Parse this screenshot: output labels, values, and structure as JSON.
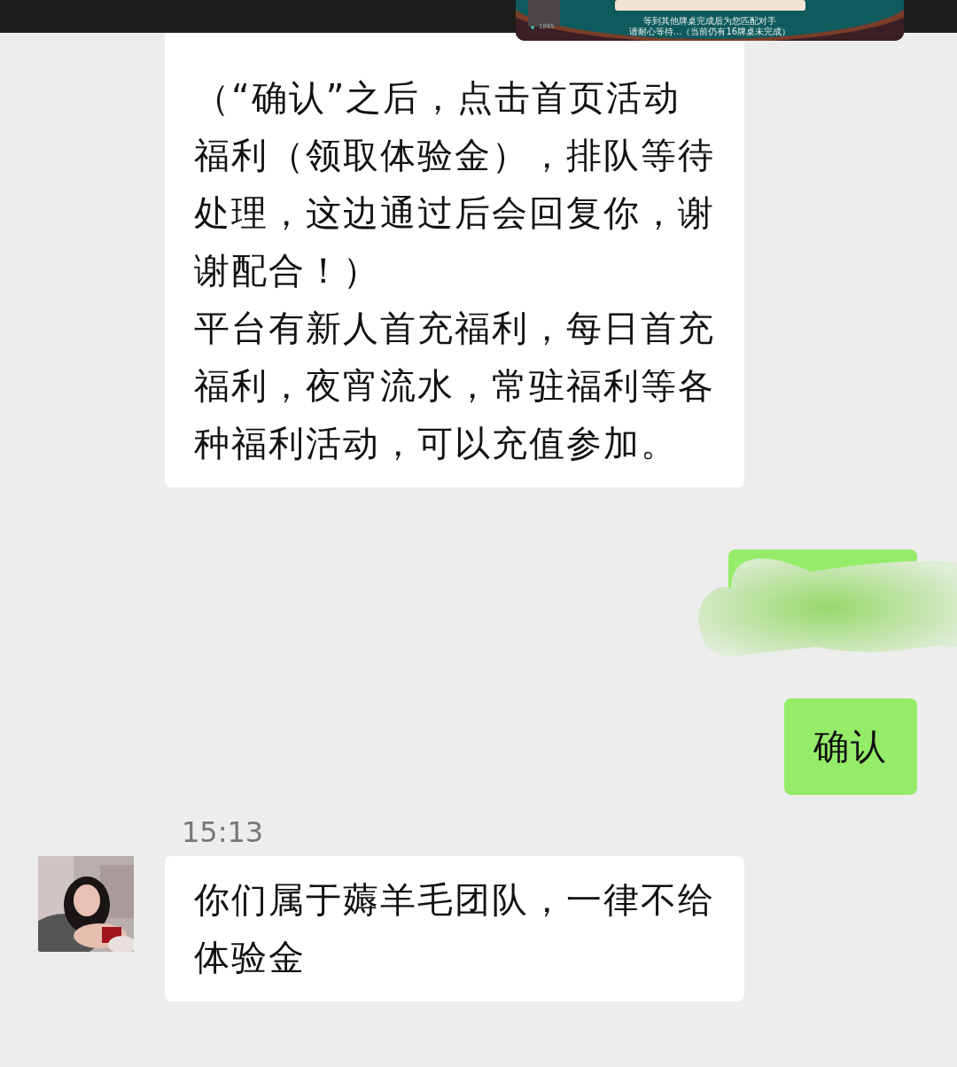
{
  "floating_window": {
    "badge": "1865",
    "captions": [
      "等到其他牌桌完成后为您匹配对手",
      "请耐心等待...（当前仍有16牌桌未完成）"
    ]
  },
  "messages": [
    {
      "kind": "incoming",
      "avatar": false,
      "lines": [
        "（“确认”之后，点击首页活动",
        "福利（领取体验金），排队等待",
        "处理，这边通过后会回复你，谢",
        "谢配合！）",
        "平台有新人首充福利，每日首充",
        "福利，夜宵流水，常驻福利等各",
        "种福利活动，可以充值参加。"
      ]
    },
    {
      "kind": "redacted"
    },
    {
      "kind": "outgoing",
      "lines": [
        "确认"
      ]
    },
    {
      "kind": "time",
      "text": "15:13"
    },
    {
      "kind": "incoming",
      "avatar": true,
      "lines": [
        "你们属于薅羊毛团队，一律不给",
        "体验金"
      ]
    }
  ]
}
